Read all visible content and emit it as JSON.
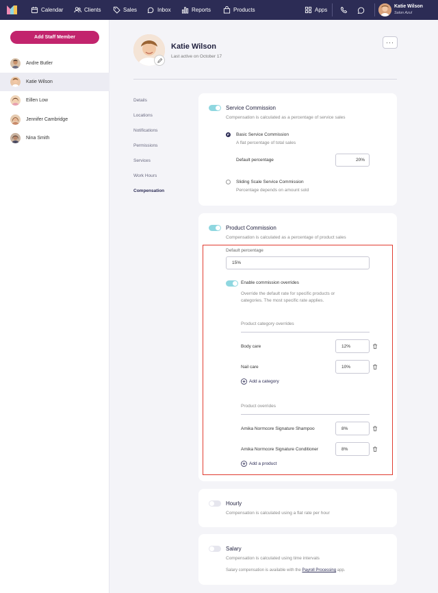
{
  "topbar": {
    "nav": [
      {
        "label": "Calendar",
        "icon": "calendar-icon"
      },
      {
        "label": "Clients",
        "icon": "clients-icon"
      },
      {
        "label": "Sales",
        "icon": "tag-icon"
      },
      {
        "label": "Inbox",
        "icon": "inbox-icon"
      },
      {
        "label": "Reports",
        "icon": "bar-chart-icon"
      },
      {
        "label": "Products",
        "icon": "bag-icon"
      }
    ],
    "apps_label": "Apps",
    "user_name": "Katie Wilson",
    "user_sub": "Salon Azul"
  },
  "sidebar": {
    "add_button": "Add Staff Member",
    "staff": [
      {
        "name": "Andre Butler"
      },
      {
        "name": "Katie Wilson"
      },
      {
        "name": "Eillen Low"
      },
      {
        "name": "Jennifer Cambridge"
      },
      {
        "name": "Nina Smith"
      }
    ]
  },
  "profile": {
    "name": "Katie Wilson",
    "last_active": "Last active on October 17",
    "more": "···"
  },
  "subnav": [
    "Details",
    "Locations",
    "Notifications",
    "Permissions",
    "Services",
    "Work Hours",
    "Compensation"
  ],
  "service_commission": {
    "title": "Service Commission",
    "desc": "Compensation is calculated as a percentage of service sales",
    "basic_title": "Basic Service Commission",
    "basic_desc": "A flat percentage of total sales",
    "default_label": "Default percentage",
    "default_value": "20%",
    "sliding_title": "Sliding Scale Service Commission",
    "sliding_desc": "Percentage depends on amount sold"
  },
  "product_commission": {
    "title": "Product Commission",
    "desc": "Compensation is calculated as a percentage of product sales",
    "default_label": "Default percentage",
    "default_value": "15%",
    "override_title": "Enable commission overrides",
    "override_desc1": "Override the default rate for specific products or",
    "override_desc2": "categories. The most specific rate applies.",
    "category_header": "Product category overrides",
    "categories": [
      {
        "name": "Body care",
        "value": "12%"
      },
      {
        "name": "Nail care",
        "value": "10%"
      }
    ],
    "add_category": "Add a category",
    "product_header": "Product overrides",
    "products": [
      {
        "name": "Amika Normcore Signature Shampoo",
        "value": "8%"
      },
      {
        "name": "Amika Normcore Signature Conditioner",
        "value": "8%"
      }
    ],
    "add_product": "Add a product"
  },
  "hourly": {
    "title": "Hourly",
    "desc": "Compensation is calculated using a flat rate per hour"
  },
  "salary": {
    "title": "Salary",
    "desc": "Compensation is calculated using time intervals",
    "note_prefix": "Salary compensation is available with the ",
    "note_link": "Payroll Processing",
    "note_suffix": " app."
  },
  "colors": {
    "topbar": "#2c2c55",
    "accent": "#c2246d",
    "toggle_on": "#8fd7e0",
    "highlight": "#e03a2e"
  }
}
